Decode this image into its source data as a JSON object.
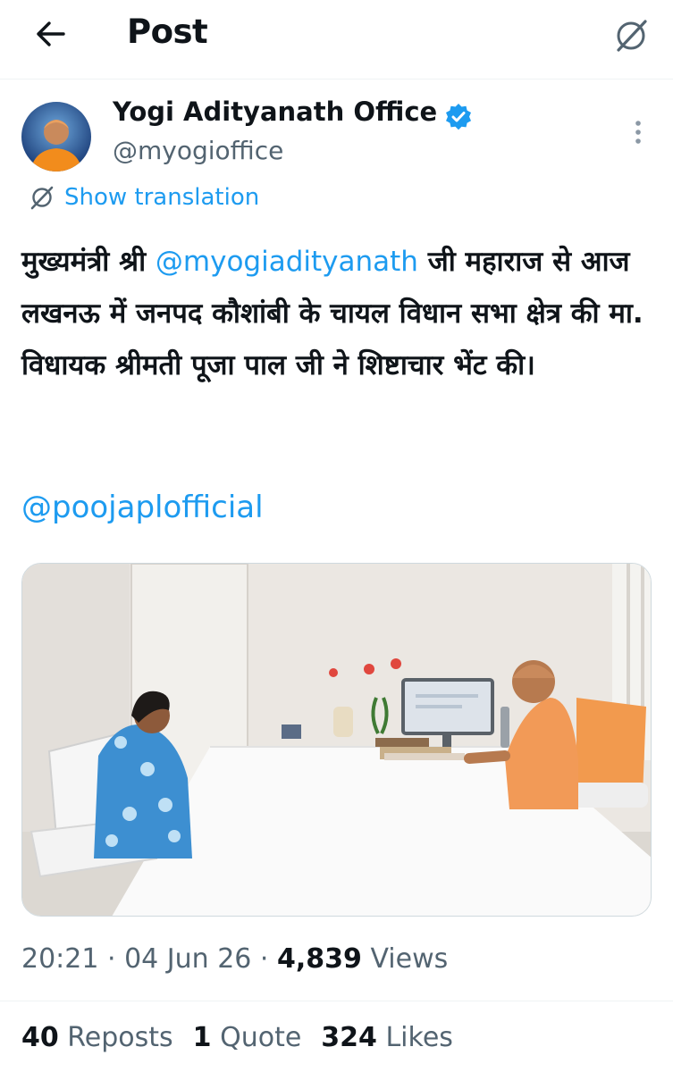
{
  "header": {
    "title": "Post",
    "back_icon": "arrow-left-icon",
    "grok_icon": "grok-icon"
  },
  "author": {
    "name": "Yogi Adityanath Office",
    "handle": "@myogioffice",
    "verified_color": "#1d9bf0"
  },
  "post": {
    "translate_label": "Show translation",
    "text_line1_pre": "मुख्यमंत्री श्री ",
    "mention1": "@myogiadityanath",
    "text_line1_post": " जी महाराज से आज लखनऊ में जनपद कौशांबी के चायल विधान सभा क्षेत्र की मा. विधायक श्रीमती पूजा पाल जी ने शिष्टाचार भेंट की।",
    "mention2": "@poojaplofficial"
  },
  "meta": {
    "time": "20:21",
    "date": "04 Jun 26",
    "views_count": "4,839",
    "views_label": "Views"
  },
  "stats": {
    "reposts_count": "40",
    "reposts_label": "Reposts",
    "quotes_count": "1",
    "quotes_label": "Quote",
    "likes_count": "324",
    "likes_label": "Likes"
  },
  "colors": {
    "accent": "#1d9bf0",
    "secondary_text": "#536471",
    "primary_text": "#0f1419"
  }
}
